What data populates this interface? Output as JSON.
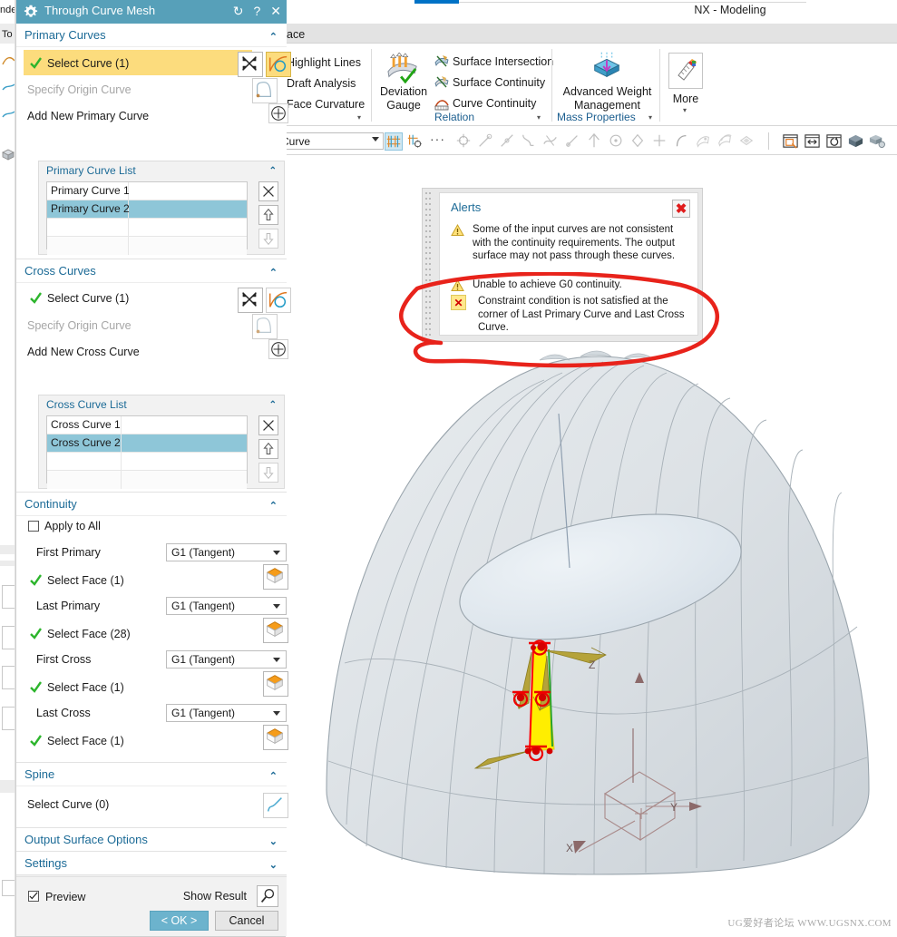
{
  "app": {
    "title": "NX - Modeling",
    "watermark": "UG爱好者论坛 WWW.UGSNX.COM",
    "ribbon_tab_context": "ace"
  },
  "ribbon": {
    "analysis_group": {
      "items": [
        "Highlight Lines",
        "Draft Analysis",
        "Face Curvature"
      ],
      "caret": "▾"
    },
    "deviation": {
      "line1": "Deviation",
      "line2": "Gauge"
    },
    "relation_group": {
      "label": "Relation",
      "caret": "▾",
      "items": [
        "Surface Intersection",
        "Surface Continuity",
        "Curve Continuity"
      ]
    },
    "mass_group": {
      "label": "Mass Properties",
      "caret": "▾",
      "item_line1": "Advanced Weight",
      "item_line2": "Management"
    },
    "more": {
      "label": "More",
      "caret": "▾"
    }
  },
  "toolbar2": {
    "filter_value": "Curve",
    "ellipsis": "···"
  },
  "alerts": {
    "title": "Alerts",
    "close_glyph": "✖",
    "messages": [
      {
        "severity": "warning",
        "text": "Some of the input curves are not consistent with the continuity requirements. The output surface may not pass through these curves."
      },
      {
        "severity": "warning",
        "text": "Unable to achieve G0 continuity."
      },
      {
        "severity": "error",
        "text": "Constraint condition is not satisfied at the corner of Last Primary Curve and Last Cross Curve."
      }
    ]
  },
  "dialog": {
    "title": "Through Curve Mesh",
    "title_buttons": [
      "↻",
      "?",
      "✕"
    ],
    "primary_curves": {
      "header": "Primary Curves",
      "chevron": "⌃",
      "select_curve": "Select Curve (1)",
      "specify_origin": "Specify Origin Curve",
      "add_new": "Add New Primary Curve",
      "list": {
        "header": "Primary Curve List",
        "chevron": "⌃",
        "rows": [
          "Primary Curve  1",
          "Primary Curve  2"
        ],
        "selected_index": 1
      }
    },
    "cross_curves": {
      "header": "Cross Curves",
      "chevron": "⌃",
      "select_curve": "Select Curve (1)",
      "specify_origin": "Specify Origin Curve",
      "add_new": "Add New Cross Curve",
      "list": {
        "header": "Cross Curve List",
        "chevron": "⌃",
        "rows": [
          "Cross Curve  1",
          "Cross Curve  2"
        ],
        "selected_index": 1
      }
    },
    "continuity": {
      "header": "Continuity",
      "chevron": "⌃",
      "apply_to_all": "Apply to All",
      "apply_to_all_checked": false,
      "rows": [
        {
          "label": "First Primary",
          "value": "G1 (Tangent)",
          "face": "Select Face (1)"
        },
        {
          "label": "Last Primary",
          "value": "G1 (Tangent)",
          "face": "Select Face (28)"
        },
        {
          "label": "First Cross",
          "value": "G1 (Tangent)",
          "face": "Select Face (1)"
        },
        {
          "label": "Last Cross",
          "value": "G1 (Tangent)",
          "face": "Select Face (1)"
        }
      ]
    },
    "spine": {
      "header": "Spine",
      "chevron": "⌃",
      "select_curve": "Select Curve (0)"
    },
    "output_surface_options": {
      "header": "Output Surface Options",
      "chevron": "⌄"
    },
    "settings": {
      "header": "Settings",
      "chevron": "⌄"
    },
    "footer": {
      "preview": "Preview",
      "preview_checked": true,
      "show_result": "Show Result",
      "ok": "< OK >",
      "cancel": "Cancel"
    }
  },
  "left_panel": {
    "labels": [
      "nde",
      "To"
    ]
  },
  "colors": {
    "dialog_title_bg": "#57a0b9",
    "section_header_text": "#1b6a96",
    "highlight_yellow": "#fcdc7d",
    "list_selection": "#8ec6d8",
    "ok_button": "#6cb3cd",
    "annotation_red": "#e01b1b",
    "tab_accent": "#0072c6"
  },
  "model": {
    "axes": [
      "Z",
      "Y",
      "X"
    ]
  }
}
